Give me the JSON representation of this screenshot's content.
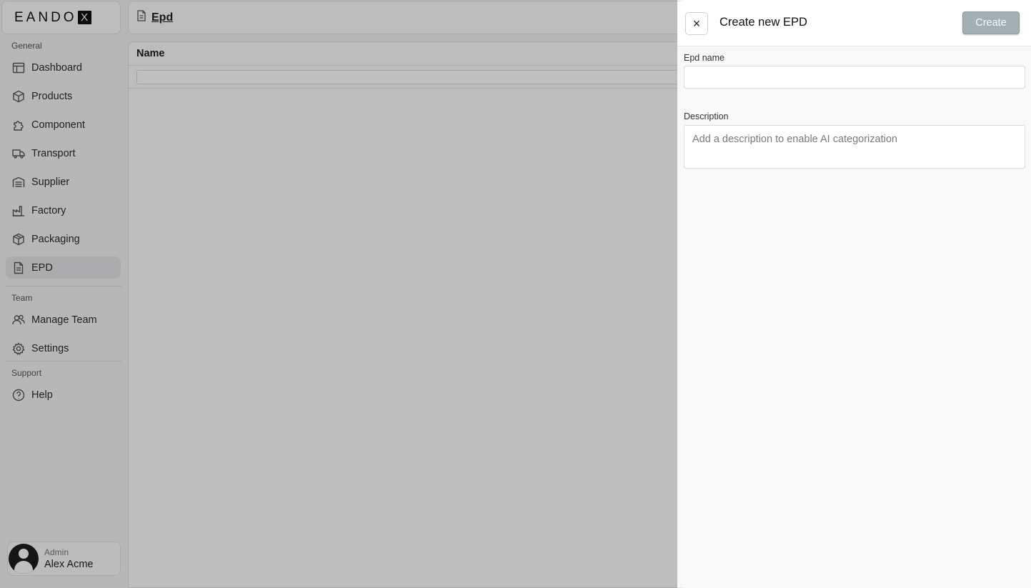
{
  "brand": {
    "logo_text": "EANDO",
    "logo_mark": "X"
  },
  "sidebar": {
    "general_label": "General",
    "items": [
      {
        "label": "Dashboard",
        "icon": "dashboard-icon"
      },
      {
        "label": "Products",
        "icon": "box-icon"
      },
      {
        "label": "Component",
        "icon": "puzzle-icon"
      },
      {
        "label": "Transport",
        "icon": "truck-icon"
      },
      {
        "label": "Supplier",
        "icon": "warehouse-icon"
      },
      {
        "label": "Factory",
        "icon": "factory-icon"
      },
      {
        "label": "Packaging",
        "icon": "package-icon"
      },
      {
        "label": "EPD",
        "icon": "document-icon",
        "active": true
      }
    ],
    "team_label": "Team",
    "team_items": [
      {
        "label": "Manage Team",
        "icon": "users-icon"
      },
      {
        "label": "Settings",
        "icon": "gear-icon"
      }
    ],
    "support_label": "Support",
    "support_items": [
      {
        "label": "Help",
        "icon": "help-icon"
      }
    ]
  },
  "user": {
    "role": "Admin",
    "name": "Alex Acme"
  },
  "main": {
    "title": "Epd",
    "table": {
      "columns": [
        "Name"
      ],
      "filter_value": ""
    }
  },
  "drawer": {
    "title": "Create new EPD",
    "create_label": "Create",
    "close_label": "×",
    "fields": {
      "name": {
        "label": "Epd name",
        "value": "",
        "placeholder": ""
      },
      "description": {
        "label": "Description",
        "value": "",
        "placeholder": "Add a description to enable AI categorization"
      }
    }
  },
  "colors": {
    "overlay": "#000000",
    "create_button": "#a3afb3",
    "active_nav": "#e6e6e8"
  }
}
